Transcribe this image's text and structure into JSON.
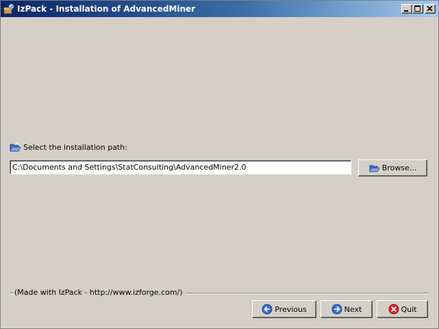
{
  "window": {
    "title": "IzPack - Installation of AdvancedMiner"
  },
  "target_panel": {
    "label": "Select the installation path:",
    "path_value": "C:\\Documents and Settings\\StatConsulting\\AdvancedMiner2.0",
    "browse_label": "Browse..."
  },
  "footer": {
    "made_with": "(Made with IzPack - http://www.izforge.com/)",
    "previous_label": "Previous",
    "next_label": "Next",
    "quit_label": "Quit"
  },
  "icons": {
    "app": "izpack-app-icon",
    "label": "open-folder-icon",
    "browse": "open-folder-icon",
    "previous": "arrow-left-icon",
    "next": "arrow-right-icon",
    "quit": "close-icon"
  },
  "colors": {
    "titlebar_start": "#0a246a",
    "titlebar_end": "#a6caf0",
    "window_bg": "#d4d0c8",
    "nav_blue": "#3b6fd1",
    "quit_red": "#d9262b"
  }
}
